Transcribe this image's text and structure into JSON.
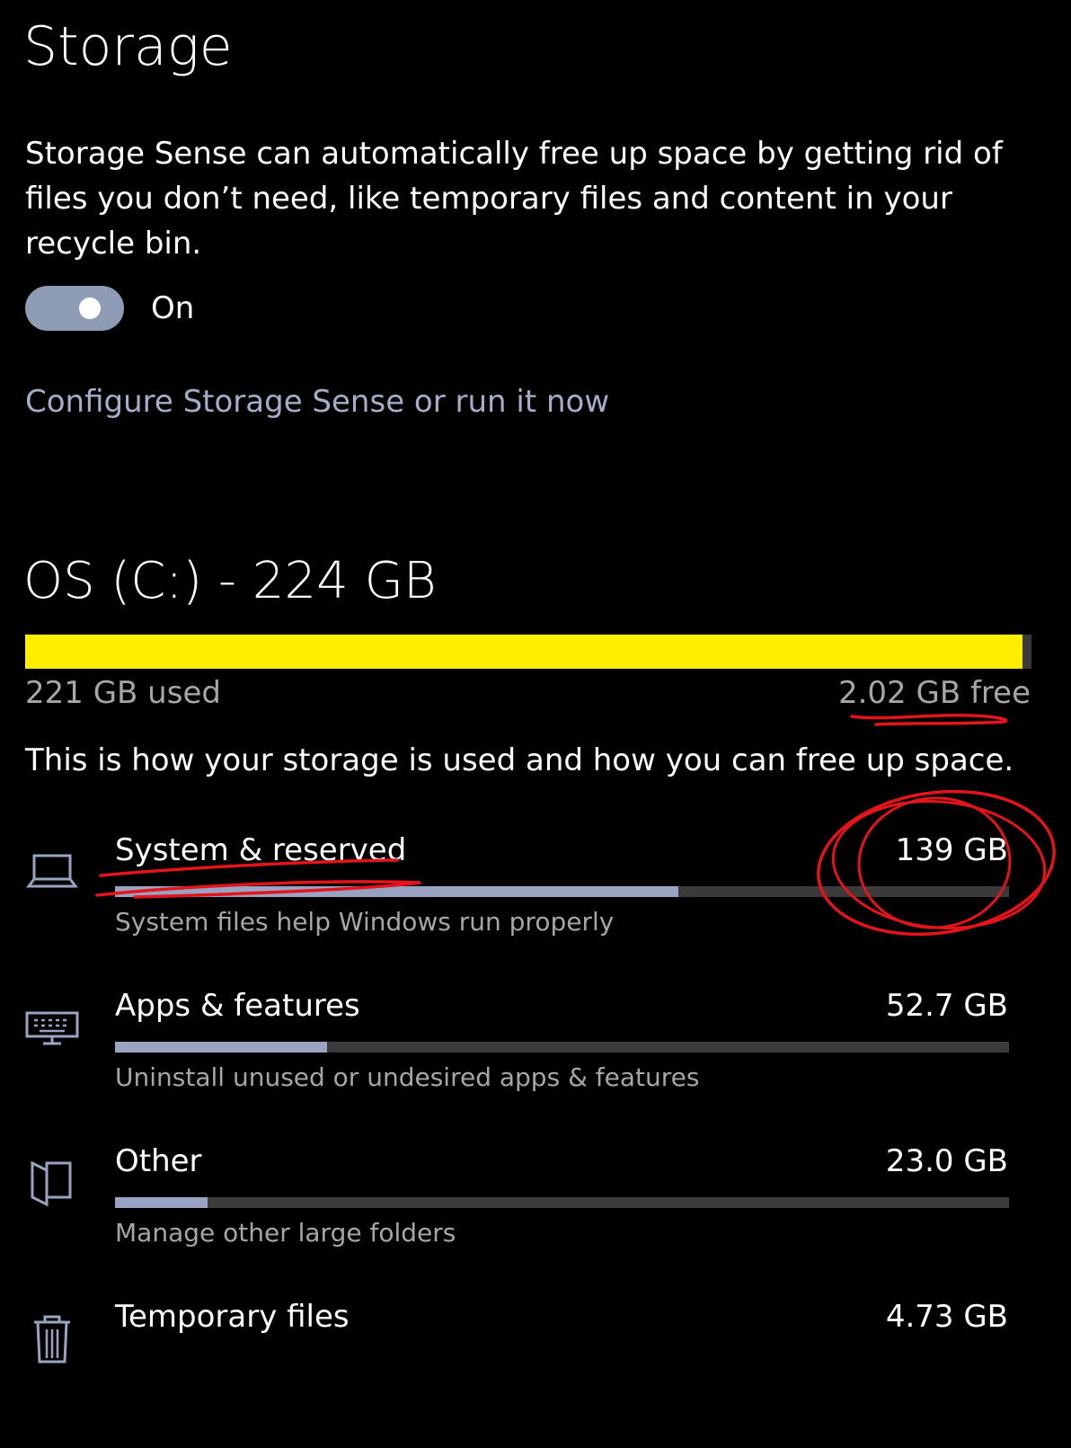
{
  "page": {
    "title": "Storage",
    "description": "Storage Sense can automatically free up space by getting rid of files you don’t need, like temporary files and content in your recycle bin.",
    "toggle_label": "On",
    "toggle_on": true,
    "configure_link": "Configure Storage Sense or run it now"
  },
  "drive": {
    "title": "OS (C:) - 224 GB",
    "used_label": "221 GB used",
    "free_label": "2.02 GB free",
    "used_fraction": 0.991,
    "bar_color": "#ffee00",
    "intro": "This is how your storage is used and how you can free up space."
  },
  "categories": [
    {
      "name": "System & reserved",
      "size": "139 GB",
      "subtitle": "System files help Windows run properly",
      "fraction": 0.63,
      "icon": "laptop-icon"
    },
    {
      "name": "Apps & features",
      "size": "52.7 GB",
      "subtitle": "Uninstall unused or undesired apps & features",
      "fraction": 0.237,
      "icon": "keyboard-monitor-icon"
    },
    {
      "name": "Other",
      "size": "23.0 GB",
      "subtitle": "Manage other large folders",
      "fraction": 0.104,
      "icon": "folder-icon"
    },
    {
      "name": "Temporary files",
      "size": "4.73 GB",
      "subtitle": "",
      "fraction": 0.021,
      "icon": "trash-icon"
    }
  ],
  "colors": {
    "background": "#000000",
    "accent_link": "#a5aec8",
    "category_fill": "#9aa3c2",
    "annotation": "#e3141a"
  }
}
